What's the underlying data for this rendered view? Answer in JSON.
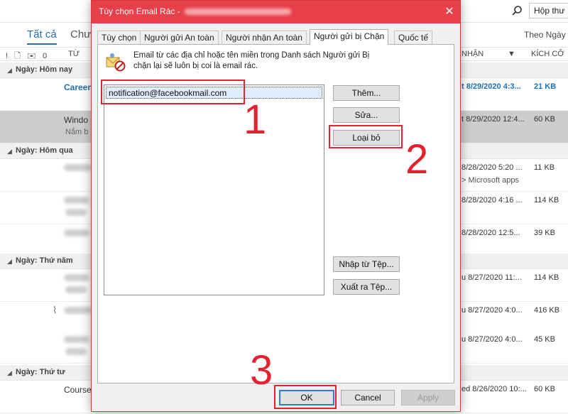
{
  "outlook": {
    "search_text": "Hộp thư",
    "tabs": [
      "Tất cả",
      "Chưa đọc"
    ],
    "sort_label": "Theo Ngày",
    "columns": {
      "icons": "! 🗋 ✉ 0",
      "from": "TỪ",
      "received": "NHẬN",
      "received_arrow": "▼",
      "size": "KÍCH CỠ"
    },
    "groups": [
      {
        "label": "Ngày: Hôm nay"
      },
      {
        "label": "Ngày: Hôm qua"
      },
      {
        "label": "Ngày: Thứ năm"
      },
      {
        "label": "Ngày: Thứ tư"
      }
    ],
    "rows": [
      {
        "sender": "Career",
        "subject": "",
        "date": "t 8/29/2020 4:3...",
        "size": "21 KB",
        "preview": ""
      },
      {
        "sender": "Windo",
        "subject": "Nắm b",
        "date": "t 8/29/2020 12:4...",
        "size": "60 KB",
        "preview": ""
      },
      {
        "sender": "",
        "subject": "",
        "date": "8/28/2020 5:20 ...",
        "size": "11 KB",
        "preview": "> Microsoft apps"
      },
      {
        "sender": "",
        "subject": "",
        "date": "8/28/2020 4:16 ...",
        "size": "114 KB",
        "preview": ""
      },
      {
        "sender": "",
        "subject": "",
        "date": "8/28/2020 12:5...",
        "size": "39 KB",
        "preview": ""
      },
      {
        "sender": "",
        "subject": "",
        "date": "u 8/27/2020 11:...",
        "size": "114 KB",
        "preview": ""
      },
      {
        "sender": "",
        "subject": "",
        "date": "u 8/27/2020 4:0...",
        "size": "416 KB",
        "preview": ""
      },
      {
        "sender": "",
        "subject": "",
        "date": "u 8/27/2020 4:0...",
        "size": "45 KB",
        "preview": ""
      },
      {
        "sender": "Course",
        "subject": "",
        "date": "ed 8/26/2020 10:...",
        "size": "60 KB",
        "preview": ""
      }
    ]
  },
  "dialog": {
    "title": "Tùy chọn Email Rác -",
    "close_glyph": "✕",
    "tabs": [
      "Tùy chọn",
      "Người gửi An toàn",
      "Người nhận An toàn",
      "Người gửi bị Chặn",
      "Quốc tế"
    ],
    "active_tab": "Người gửi bị Chặn",
    "info_text": "Email từ các địa chỉ hoặc tên miền trong Danh sách Người gửi Bị chặn lại sẽ luôn bị coi là email rác.",
    "blocked_list": [
      "notification@facebookmail.com"
    ],
    "buttons": {
      "add": "Thêm...",
      "edit": "Sửa...",
      "remove": "Loại bỏ",
      "import": "Nhập từ Tệp...",
      "export": "Xuất ra Tệp...",
      "ok": "OK",
      "cancel": "Cancel",
      "apply": "Apply"
    }
  },
  "annotations": {
    "step1": "1",
    "step2": "2",
    "step3": "3",
    "color": "#e3212f"
  },
  "colors": {
    "title_bar": "#e8404a",
    "accent": "#2b6cb0",
    "annotation": "#e3212f"
  }
}
